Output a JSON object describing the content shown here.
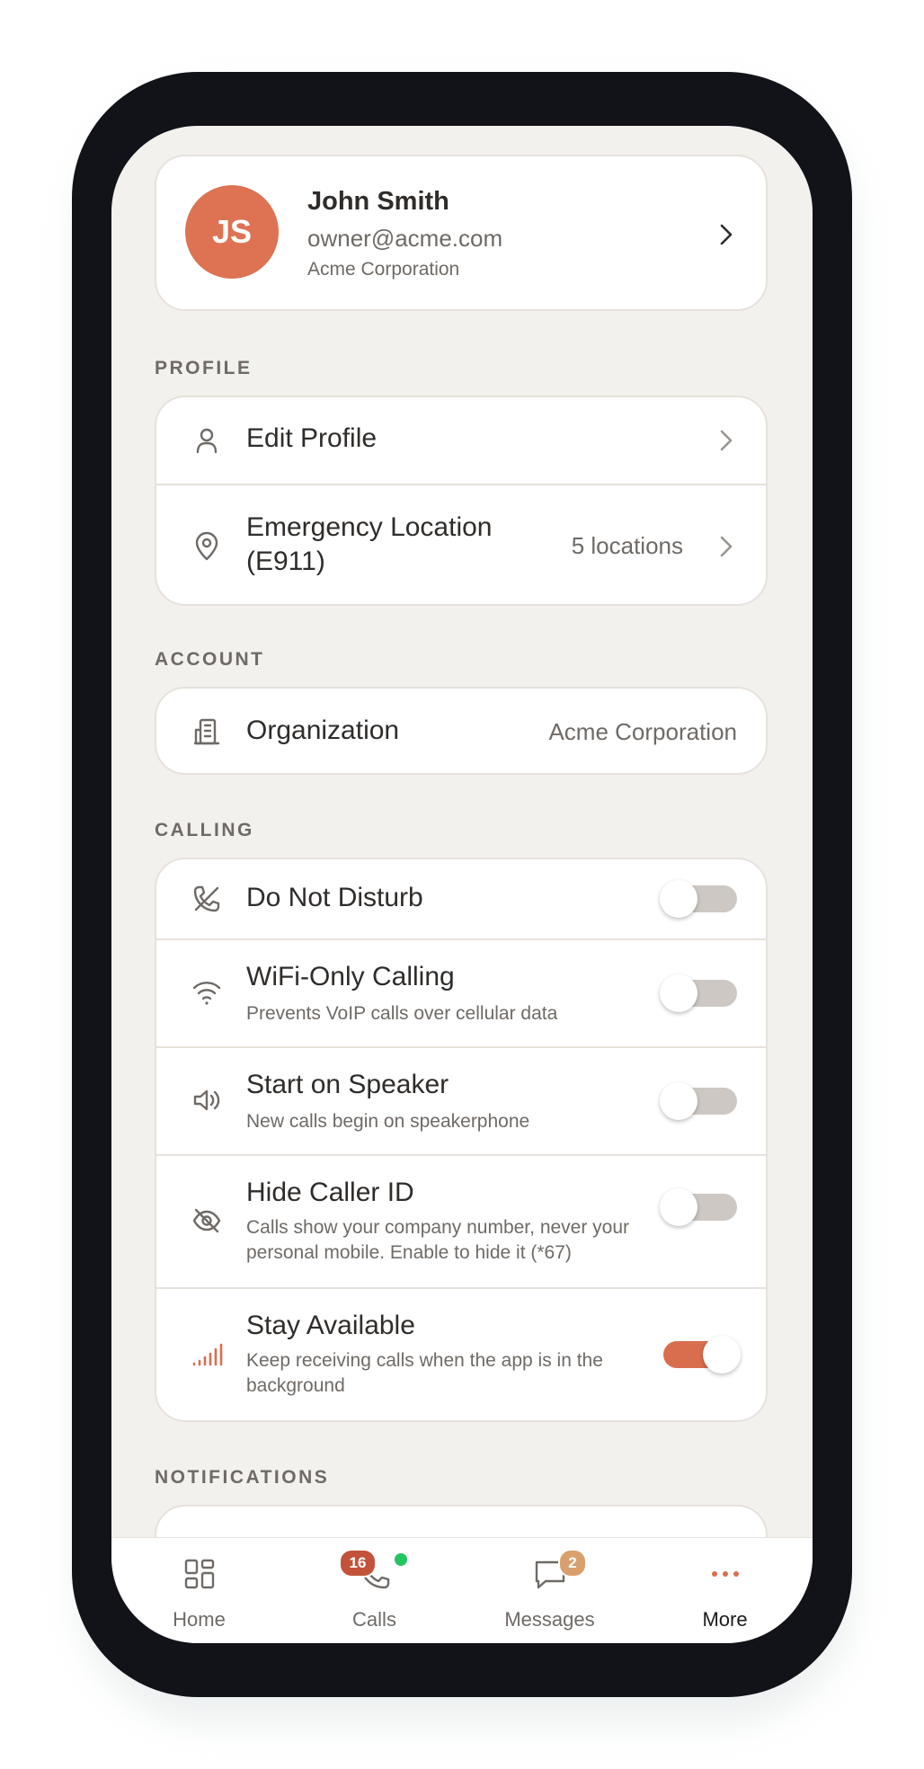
{
  "profile_card": {
    "initials": "JS",
    "name": "John Smith",
    "email": "owner@acme.com",
    "company": "Acme Corporation"
  },
  "sections": {
    "profile": "PROFILE",
    "account": "ACCOUNT",
    "calling": "CALLING",
    "notifications": "NOTIFICATIONS"
  },
  "profile_items": {
    "edit_profile": "Edit Profile",
    "emergency_line1": "Emergency Location",
    "emergency_line2": "(E911)",
    "emergency_value": "5 locations"
  },
  "account_items": {
    "organization": "Organization",
    "organization_value": "Acme Corporation"
  },
  "calling_items": {
    "dnd": {
      "title": "Do Not Disturb",
      "on": false
    },
    "wifi": {
      "title": "WiFi-Only Calling",
      "subtitle": "Prevents VoIP calls over cellular data",
      "on": false
    },
    "speaker": {
      "title": "Start on Speaker",
      "subtitle": "New calls begin on speakerphone",
      "on": false
    },
    "callerid": {
      "title": "Hide Caller ID",
      "subtitle": "Calls show your company number, never your personal mobile. Enable to hide it (*67)",
      "on": false
    },
    "available": {
      "title": "Stay Available",
      "subtitle": "Keep receiving calls when the app is in the background",
      "on": true
    }
  },
  "tabbar": {
    "home": "Home",
    "calls": "Calls",
    "calls_badge": "16",
    "messages": "Messages",
    "messages_badge": "2",
    "more": "More",
    "active": "More"
  },
  "colors": {
    "accent": "#d96e4f",
    "avatar": "#dd7353",
    "online": "#22c55e",
    "messages_badge": "#d9a06e",
    "calls_badge": "#c2533a"
  }
}
